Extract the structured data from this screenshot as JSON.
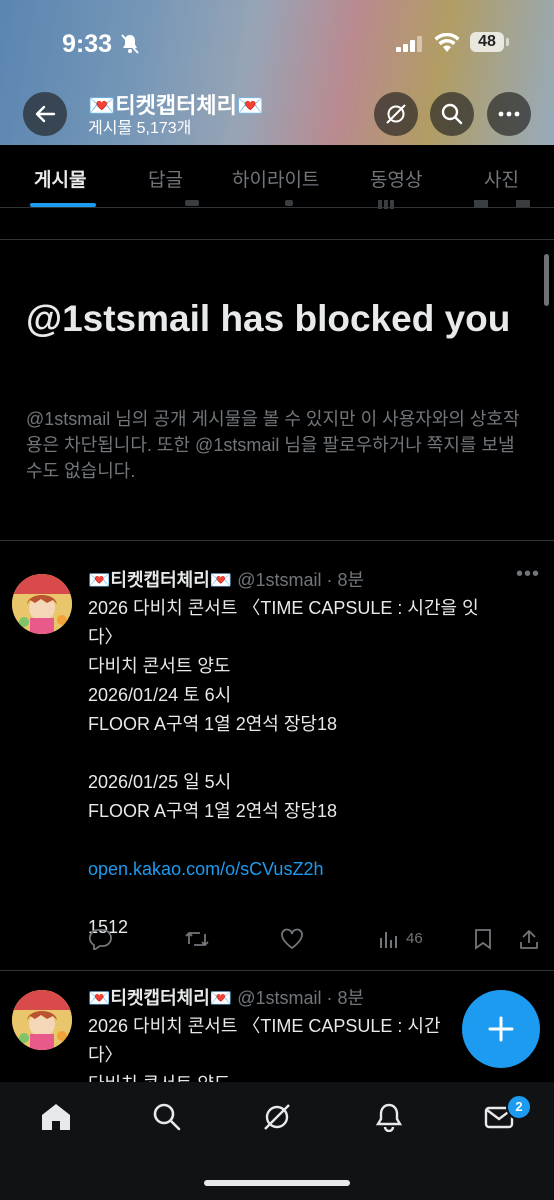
{
  "status_bar": {
    "time": "9:33",
    "battery": "48"
  },
  "profile": {
    "name": "💌티켓캡터체리💌",
    "post_count": "게시물 5,173개"
  },
  "tabs": [
    {
      "label": "게시물",
      "active": true
    },
    {
      "label": "답글",
      "active": false
    },
    {
      "label": "하이라이트",
      "active": false
    },
    {
      "label": "동영상",
      "active": false
    },
    {
      "label": "사진",
      "active": false
    }
  ],
  "block_notice": {
    "title": "@1stsmail has blocked you",
    "description": "@1stsmail 님의 공개 게시물을 볼 수 있지만 이 사용자와의 상호작용은 차단됩니다. 또한 @1stsmail 님을 팔로우하거나 쪽지를 보낼 수도 없습니다."
  },
  "tweets": [
    {
      "name": "💌티켓캡터체리💌",
      "meta": "@1stsmail · 8분",
      "lines": [
        "2026 다비치 콘서트 〈TIME CAPSULE : 시간을 잇",
        "다〉",
        "다비치 콘서트 양도",
        "2026/01/24 토 6시",
        "FLOOR A구역 1열 2연석  장당18",
        "",
        "2026/01/25 일 5시",
        "FLOOR A구역 1열 2연석   장당18",
        ""
      ],
      "link": "open.kakao.com/o/sCVusZ2h",
      "tail": "1512",
      "views": "46"
    },
    {
      "name": "💌티켓캡터체리💌",
      "meta": "@1stsmail · 8분",
      "lines": [
        "2026 다비치 콘서트 〈TIME CAPSULE : 시간",
        "다〉",
        "다비치 콘서트 양도"
      ]
    }
  ],
  "nav": {
    "messages_badge": "2"
  },
  "icons": [
    "back-icon",
    "grok-icon",
    "search-icon",
    "more-icon",
    "reply-icon",
    "retweet-icon",
    "like-icon",
    "views-icon",
    "bookmark-icon",
    "share-icon",
    "compose-icon",
    "home-icon",
    "notifications-icon",
    "messages-icon"
  ],
  "colors": {
    "accent": "#1d9bf0",
    "background": "#000000",
    "muted_text": "#71767b",
    "divider": "#2f3336"
  }
}
